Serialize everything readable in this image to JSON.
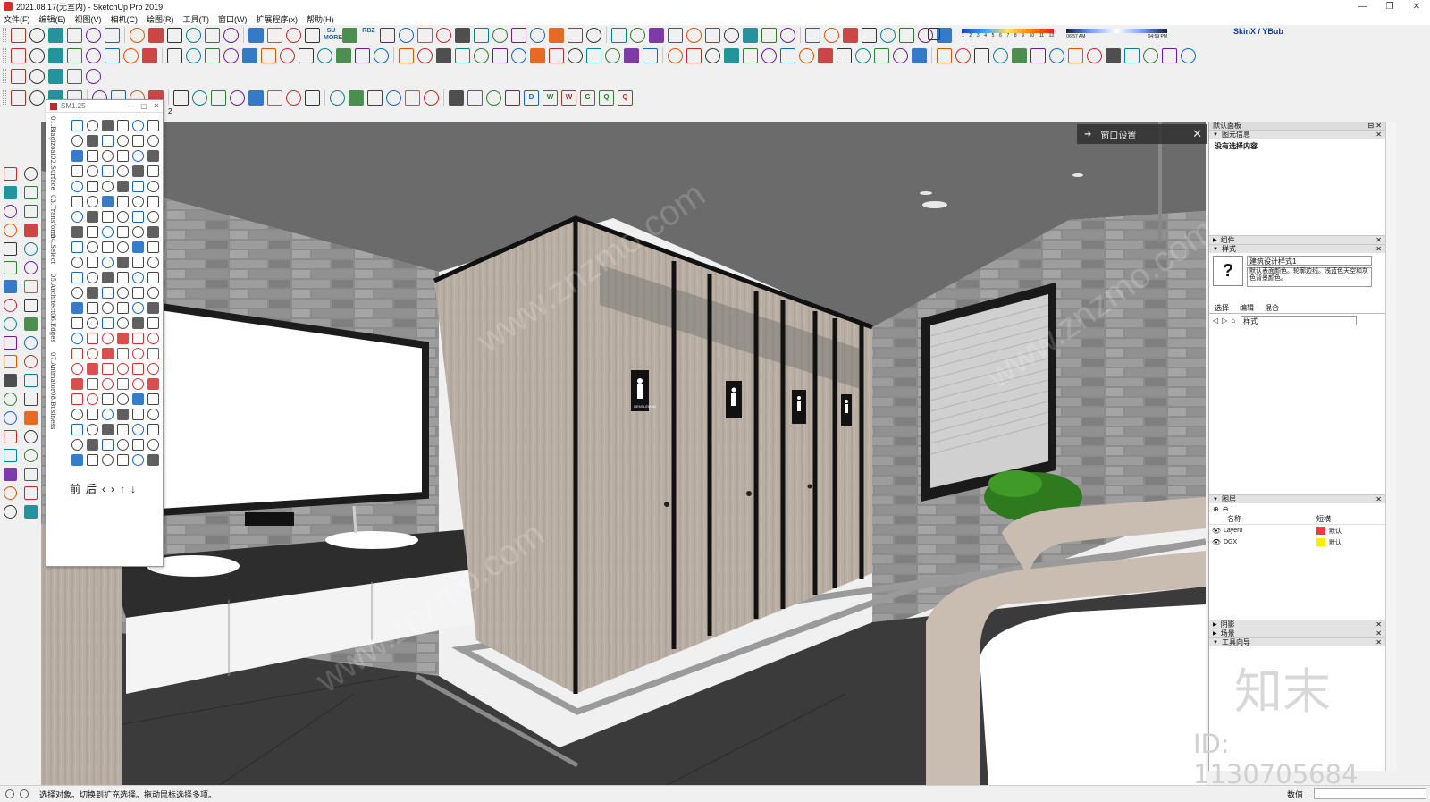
{
  "window": {
    "title": "2021.08.17(无室内) - SketchUp Pro 2019",
    "controls": [
      "—",
      "❐",
      "✕"
    ]
  },
  "menu": [
    "文件(F)",
    "编辑(E)",
    "视图(V)",
    "相机(C)",
    "绘图(R)",
    "工具(T)",
    "窗口(W)",
    "扩展程序(x)",
    "帮助(H)"
  ],
  "toolbar": {
    "su_more": "SU MORE",
    "rbz": "RBZ",
    "skinx": "SkinX / YBub",
    "months": [
      "1",
      "2",
      "3",
      "4",
      "5",
      "6",
      "7",
      "8",
      "9",
      "10",
      "11",
      "12"
    ],
    "time_start": "06:57 AM",
    "time_mid": "中午",
    "time_end": "04:59 PM",
    "letters": [
      "D",
      "W",
      "W",
      "G",
      "Q",
      "Q"
    ],
    "row3_extra": "2"
  },
  "floating_toolbar": {
    "title": "SM1.25",
    "tabs": [
      "01.Biaglzoai",
      "02.Surface",
      "03.Transform",
      "04.Select",
      "05.Architect",
      "06.Edges",
      "07.Animator",
      "08.Business"
    ],
    "nav": [
      "前",
      "后"
    ],
    "colors": {
      "red": "#d32f2f",
      "blue": "#1565c0",
      "gray": "#444444"
    }
  },
  "viewport": {
    "window_settings": "窗口设置",
    "sign_text": "GENTLEMAN",
    "watermark": "www.znzmo.com"
  },
  "tray": {
    "title": "默认面板",
    "entity_info": {
      "header": "图元信息",
      "body": "没有选择内容"
    },
    "components": "组件",
    "styles": {
      "header": "样式",
      "name": "建筑设计样式1",
      "desc": "默认表面颜色。轮廓边线。浅蓝色天空和灰色背景颜色。",
      "tabs": [
        "选择",
        "编辑",
        "混合"
      ],
      "dropdown": "样式"
    },
    "layers": {
      "header": "图层",
      "col_name": "名称",
      "col_linetype": "短横",
      "rows": [
        {
          "name": "Layer0",
          "color": "#e84040",
          "linetype": "默认"
        },
        {
          "name": "DGX",
          "color": "#f7f000",
          "linetype": "默认"
        }
      ]
    },
    "shadows": "阴影",
    "scenes": "场景",
    "instructor": "工具向导",
    "logo": "知末",
    "id_text": "ID: 1130705684"
  },
  "status": {
    "message": "选择对象。切换到扩充选择。拖动鼠标选择多项。",
    "vcb_label": "数值"
  }
}
